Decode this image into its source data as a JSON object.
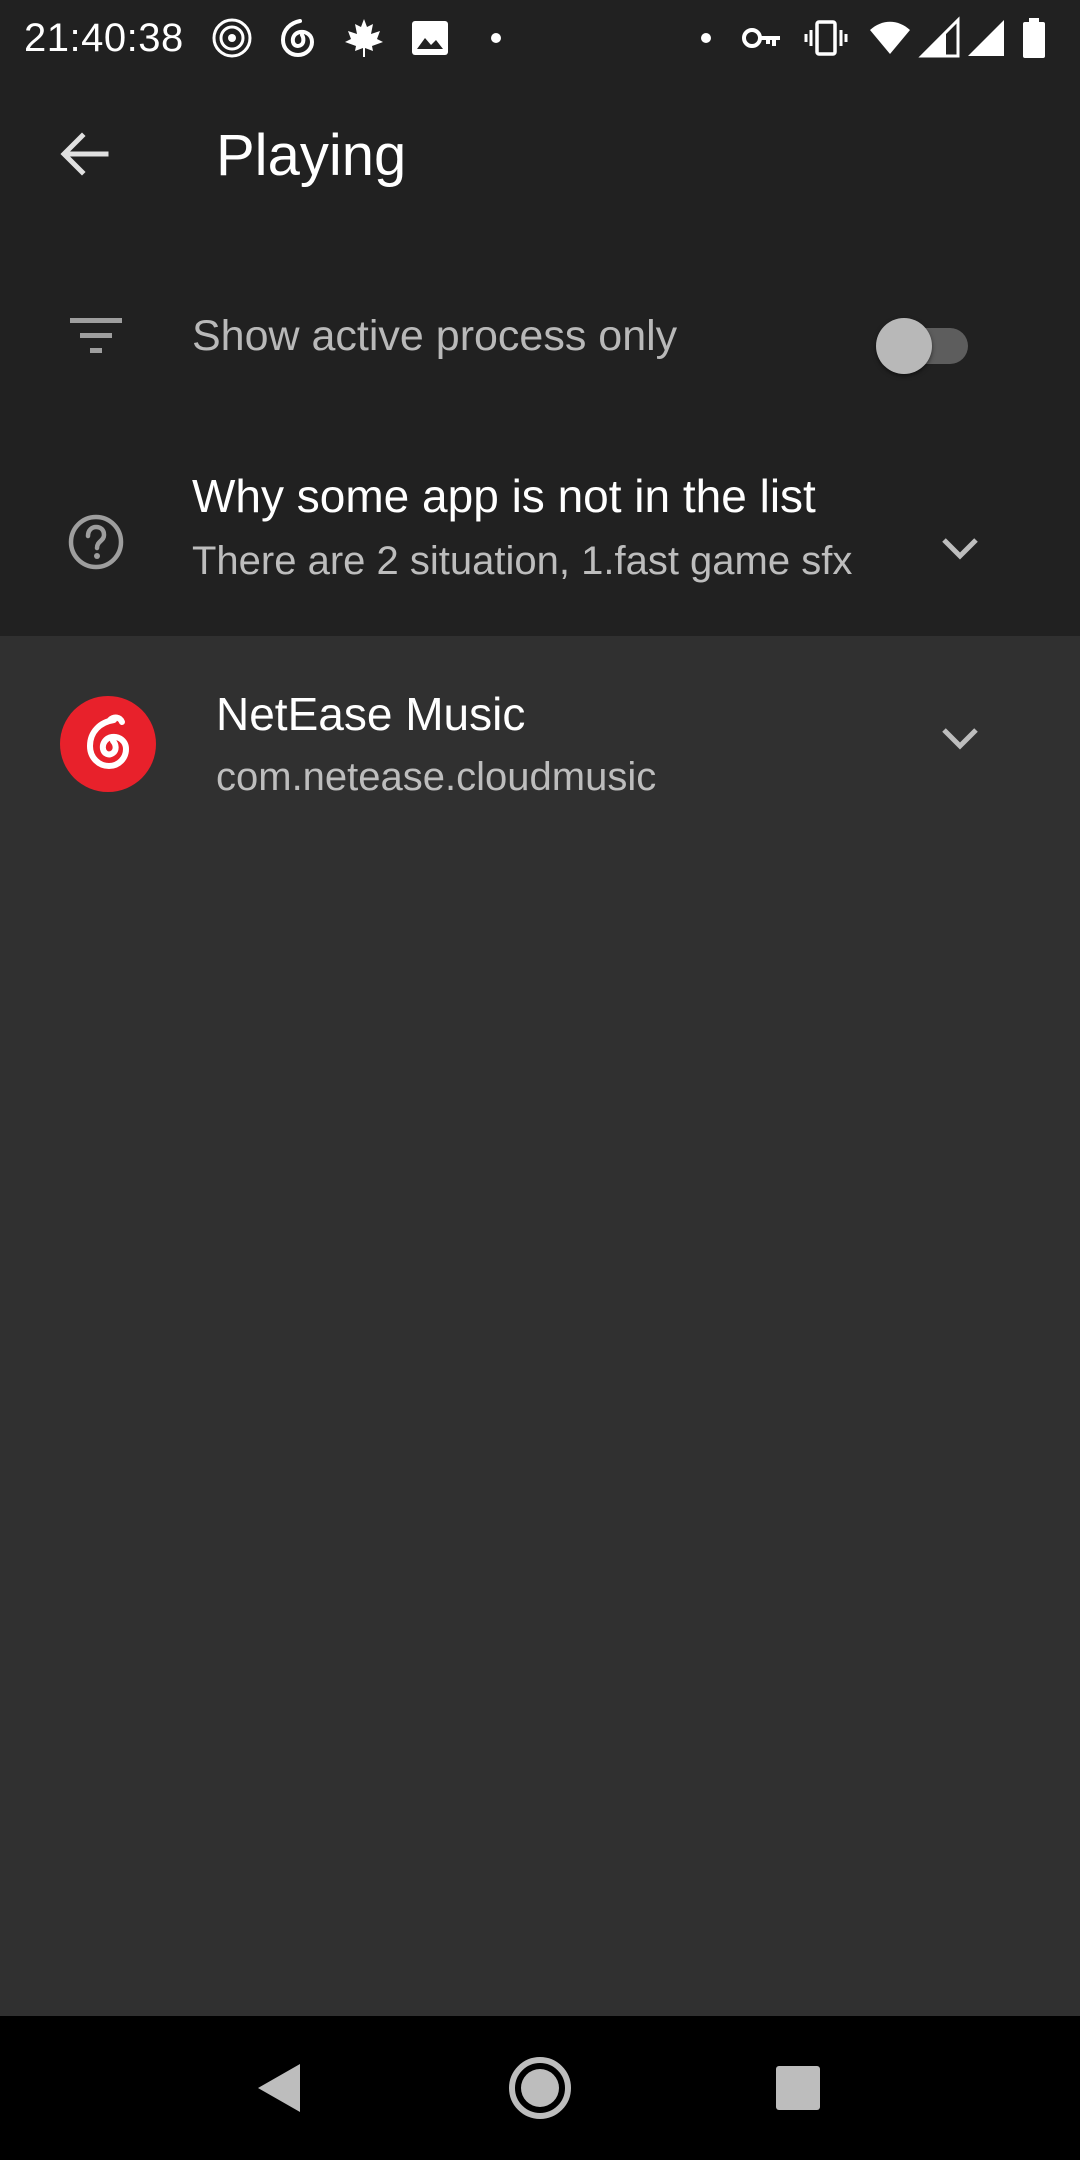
{
  "status_bar": {
    "time": "21:40:38",
    "left_icons": [
      "vinyl-record-icon",
      "netease-music-icon",
      "maple-leaf-icon",
      "image-icon",
      "notification-dot-icon"
    ],
    "right_icons": [
      "notification-dot-icon",
      "vpn-key-icon",
      "vibrate-icon",
      "wifi-icon",
      "signal-icon",
      "signal-icon",
      "battery-icon"
    ]
  },
  "app_bar": {
    "back_icon": "arrow-back-icon",
    "title": "Playing"
  },
  "filter": {
    "icon": "filter-list-icon",
    "label": "Show active process only",
    "enabled": false
  },
  "help": {
    "icon": "help-circle-icon",
    "title": "Why some app is not in the list",
    "subtitle": "There are 2 situation, 1.fast game sfx",
    "expand_icon": "chevron-down-icon"
  },
  "apps": [
    {
      "name": "NetEase Music",
      "package": "com.netease.cloudmusic",
      "icon": "netease-music-icon",
      "icon_color": "#e8212b",
      "expand_icon": "chevron-down-icon"
    }
  ],
  "nav_bar": {
    "back": "nav-back-icon",
    "home": "nav-home-icon",
    "recents": "nav-recents-icon"
  },
  "colors": {
    "background": "#303030",
    "surface": "#212121",
    "accent_red": "#e8212b"
  }
}
